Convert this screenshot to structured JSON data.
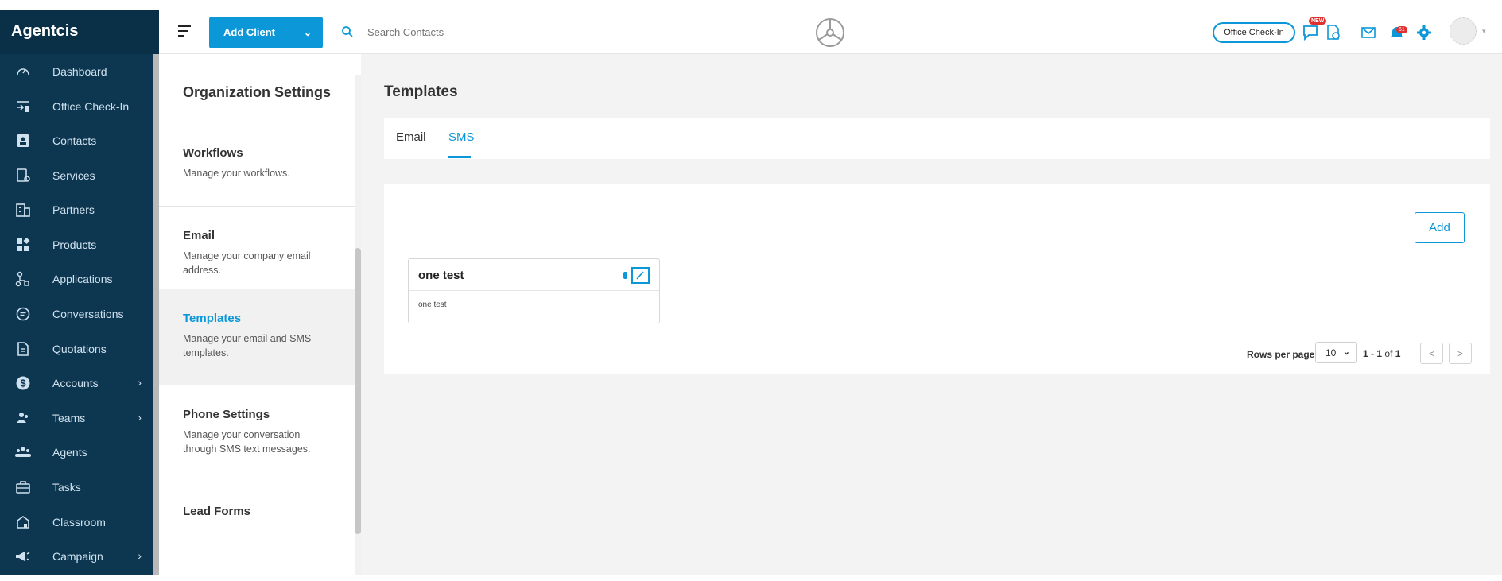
{
  "nav": {
    "brand": "Agentcis",
    "items": [
      {
        "label": "Dashboard",
        "icon": "gauge-icon"
      },
      {
        "label": "Office Check-In",
        "icon": "checkin-icon"
      },
      {
        "label": "Contacts",
        "icon": "contact-card-icon"
      },
      {
        "label": "Services",
        "icon": "services-icon"
      },
      {
        "label": "Partners",
        "icon": "building-icon"
      },
      {
        "label": "Products",
        "icon": "products-icon"
      },
      {
        "label": "Applications",
        "icon": "flow-icon"
      },
      {
        "label": "Conversations",
        "icon": "chat-icon"
      },
      {
        "label": "Quotations",
        "icon": "document-icon"
      },
      {
        "label": "Accounts",
        "icon": "dollar-icon"
      },
      {
        "label": "Teams",
        "icon": "team-icon"
      },
      {
        "label": "Agents",
        "icon": "agents-icon"
      },
      {
        "label": "Tasks",
        "icon": "briefcase-icon"
      },
      {
        "label": "Classroom",
        "icon": "classroom-icon"
      },
      {
        "label": "Campaign",
        "icon": "megaphone-icon"
      }
    ]
  },
  "topbar": {
    "add_client": "Add Client",
    "search_placeholder": "Search Contacts",
    "office_checkin": "Office Check-In",
    "new_badge": "NEW",
    "notification_count": "61"
  },
  "settings": {
    "title": "Organization Settings",
    "items": [
      {
        "title": "Workflows",
        "desc": "Manage your workflows."
      },
      {
        "title": "Email",
        "desc": "Manage your company email address."
      },
      {
        "title": "Templates",
        "desc": "Manage your email and SMS templates."
      },
      {
        "title": "Phone Settings",
        "desc": "Manage your conversation through SMS text messages."
      },
      {
        "title": "Lead Forms",
        "desc": ""
      }
    ]
  },
  "main": {
    "title": "Templates",
    "tabs": [
      "Email",
      "SMS"
    ],
    "active_tab": "SMS",
    "add_label": "Add",
    "card": {
      "title": "one test",
      "body": "one test"
    },
    "pagination": {
      "rows_label": "Rows per page",
      "rows_value": "10",
      "range_start": "1",
      "range_end": "1",
      "range_of": "of",
      "total": "1",
      "prev": "<",
      "next": ">"
    }
  },
  "colors": {
    "accent": "#0b97d8",
    "nav_bg": "#0d3650",
    "badge": "#e0302f"
  }
}
